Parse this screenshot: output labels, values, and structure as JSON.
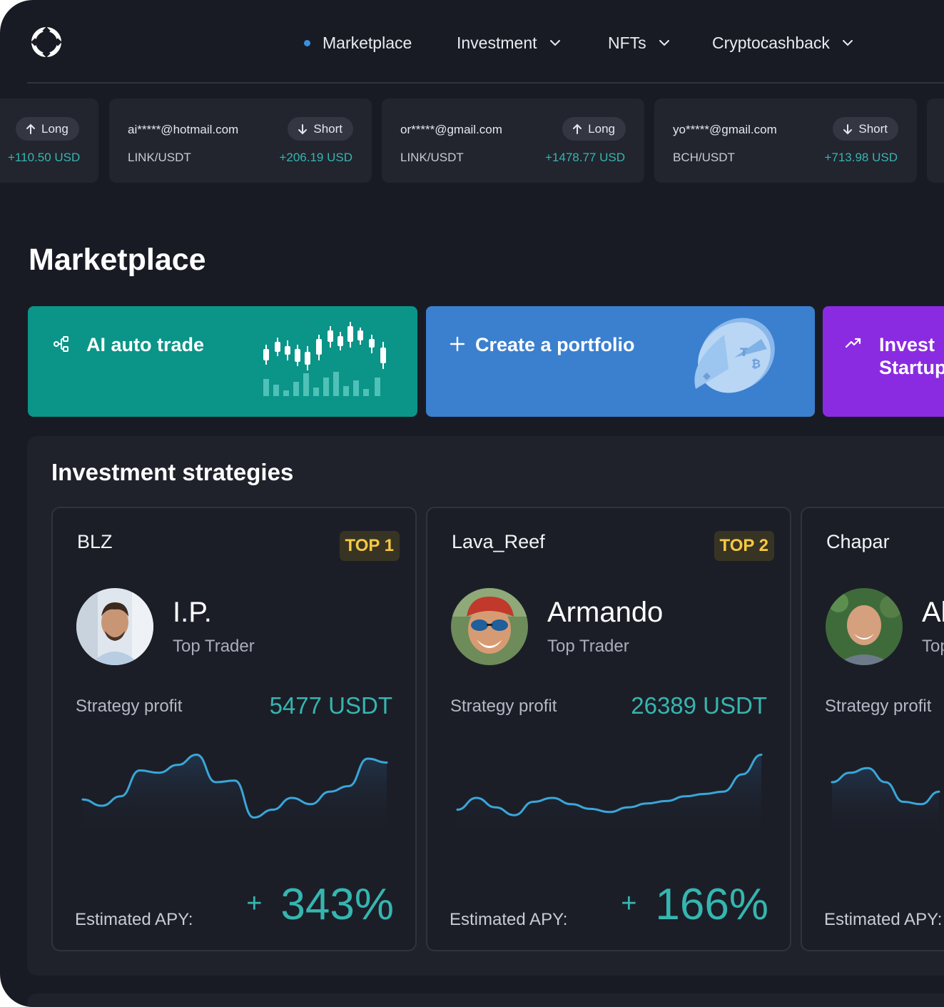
{
  "header": {
    "nav": [
      {
        "label": "Marketplace",
        "active": true,
        "dropdown": false
      },
      {
        "label": "Investment",
        "active": false,
        "dropdown": true
      },
      {
        "label": "NFTs",
        "active": false,
        "dropdown": true
      },
      {
        "label": "Cryptocashback",
        "active": false,
        "dropdown": true
      }
    ]
  },
  "ticker": [
    {
      "email": "",
      "pair": "",
      "direction": "Long",
      "profit": "+110.50 USD"
    },
    {
      "email": "ai*****@hotmail.com",
      "pair": "LINK/USDT",
      "direction": "Short",
      "profit": "+206.19 USD"
    },
    {
      "email": "or*****@gmail.com",
      "pair": "LINK/USDT",
      "direction": "Long",
      "profit": "+1478.77 USD"
    },
    {
      "email": "yo*****@gmail.com",
      "pair": "BCH/USDT",
      "direction": "Short",
      "profit": "+713.98 USD"
    }
  ],
  "marketplace": {
    "title": "Marketplace",
    "actions": [
      {
        "label": "AI auto trade",
        "icon": "network-nodes-icon",
        "color": "#0b9488"
      },
      {
        "label": "Create a portfolio",
        "icon": "plus-icon",
        "color": "#3b7fcf"
      },
      {
        "label_line1": "Invest",
        "label_line2": "Startup",
        "icon": "trend-up-icon",
        "color": "#8a2be2"
      }
    ]
  },
  "strategies": {
    "title": "Investment strategies",
    "profit_label": "Strategy profit",
    "apy_label": "Estimated APY:",
    "cards": [
      {
        "name": "BLZ",
        "badge": "TOP 1",
        "trader": "I.P.",
        "role": "Top Trader",
        "profit": "5477 USDT",
        "apy_plus": "+",
        "apy": "343%",
        "spark": [
          0.38,
          0.3,
          0.42,
          0.75,
          0.72,
          0.82,
          0.95,
          0.6,
          0.62,
          0.15,
          0.25,
          0.4,
          0.32,
          0.48,
          0.55,
          0.9,
          0.85
        ]
      },
      {
        "name": "Lava_Reef",
        "badge": "TOP 2",
        "trader": "Armando",
        "role": "Top Trader",
        "profit": "26389 USDT",
        "apy_plus": "+",
        "apy": "166%",
        "spark": [
          0.25,
          0.4,
          0.28,
          0.18,
          0.35,
          0.4,
          0.32,
          0.26,
          0.22,
          0.28,
          0.33,
          0.36,
          0.42,
          0.45,
          0.48,
          0.7,
          0.95
        ]
      },
      {
        "name": "Chapar",
        "badge": "",
        "trader": "Al",
        "role": "Top",
        "profit": "",
        "apy_plus": "",
        "apy": "",
        "spark": [
          0.6,
          0.72,
          0.78,
          0.6,
          0.35,
          0.32,
          0.48
        ]
      }
    ]
  }
}
